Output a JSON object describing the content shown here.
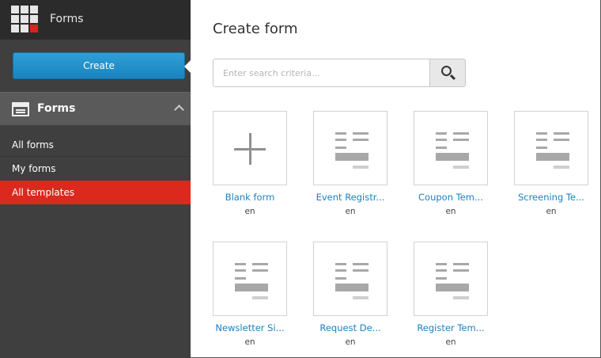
{
  "app": {
    "title": "Forms"
  },
  "sidebar": {
    "create_label": "Create",
    "section_title": "Forms",
    "items": [
      {
        "label": "All forms"
      },
      {
        "label": "My forms"
      },
      {
        "label": "All templates",
        "active": true
      }
    ]
  },
  "main": {
    "title": "Create form",
    "search": {
      "placeholder": "Enter search criteria...",
      "value": ""
    },
    "templates": [
      {
        "name": "Blank form",
        "lang": "en",
        "icon": "plus-icon"
      },
      {
        "name": "Event Registr...",
        "lang": "en",
        "icon": "form-template-icon"
      },
      {
        "name": "Coupon Tem...",
        "lang": "en",
        "icon": "form-template-icon"
      },
      {
        "name": "Screening Te...",
        "lang": "en",
        "icon": "form-template-icon"
      },
      {
        "name": "Newsletter Si...",
        "lang": "en",
        "icon": "form-template-icon"
      },
      {
        "name": "Request De...",
        "lang": "en",
        "icon": "form-template-icon"
      },
      {
        "name": "Register Tem...",
        "lang": "en",
        "icon": "form-template-icon"
      }
    ]
  },
  "colors": {
    "accent": "#1b82bf",
    "active_nav": "#dc291e",
    "sidebar_bg": "#3f3f3f",
    "topbar_bg": "#2b2b2b"
  }
}
